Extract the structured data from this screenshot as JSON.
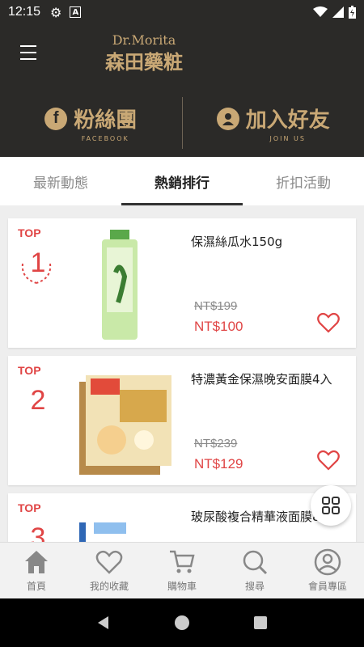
{
  "status_bar": {
    "time": "12:15",
    "a_icon_label": "A"
  },
  "brand": {
    "name_en": "Dr.Morita",
    "name_zh": "森田藥粧"
  },
  "banner": {
    "facebook": {
      "title": "粉絲團",
      "subtitle": "FACEBOOK"
    },
    "join": {
      "title": "加入好友",
      "subtitle": "JOIN US"
    }
  },
  "tabs": [
    {
      "label": "最新動態",
      "active": false
    },
    {
      "label": "熱銷排行",
      "active": true
    },
    {
      "label": "折扣活動",
      "active": false
    }
  ],
  "products": [
    {
      "top_label": "TOP",
      "rank": "1",
      "name": "保濕絲瓜水150g",
      "original_price": "NT$199",
      "sale_price": "NT$100"
    },
    {
      "top_label": "TOP",
      "rank": "2",
      "name": "特濃黃金保濕晚安面膜4入",
      "original_price": "NT$239",
      "sale_price": "NT$129"
    },
    {
      "top_label": "TOP",
      "rank": "3",
      "name": "玻尿酸複合精華液面膜8入",
      "original_price": "",
      "sale_price": ""
    }
  ],
  "bottom_nav": [
    {
      "label": "首頁",
      "icon": "home-icon"
    },
    {
      "label": "我的收藏",
      "icon": "heart-icon"
    },
    {
      "label": "購物車",
      "icon": "cart-icon"
    },
    {
      "label": "搜尋",
      "icon": "search-icon"
    },
    {
      "label": "會員專區",
      "icon": "user-icon"
    }
  ],
  "colors": {
    "header_bg": "#2b2a28",
    "gold": "#c9a875",
    "accent_red": "#e04545"
  }
}
